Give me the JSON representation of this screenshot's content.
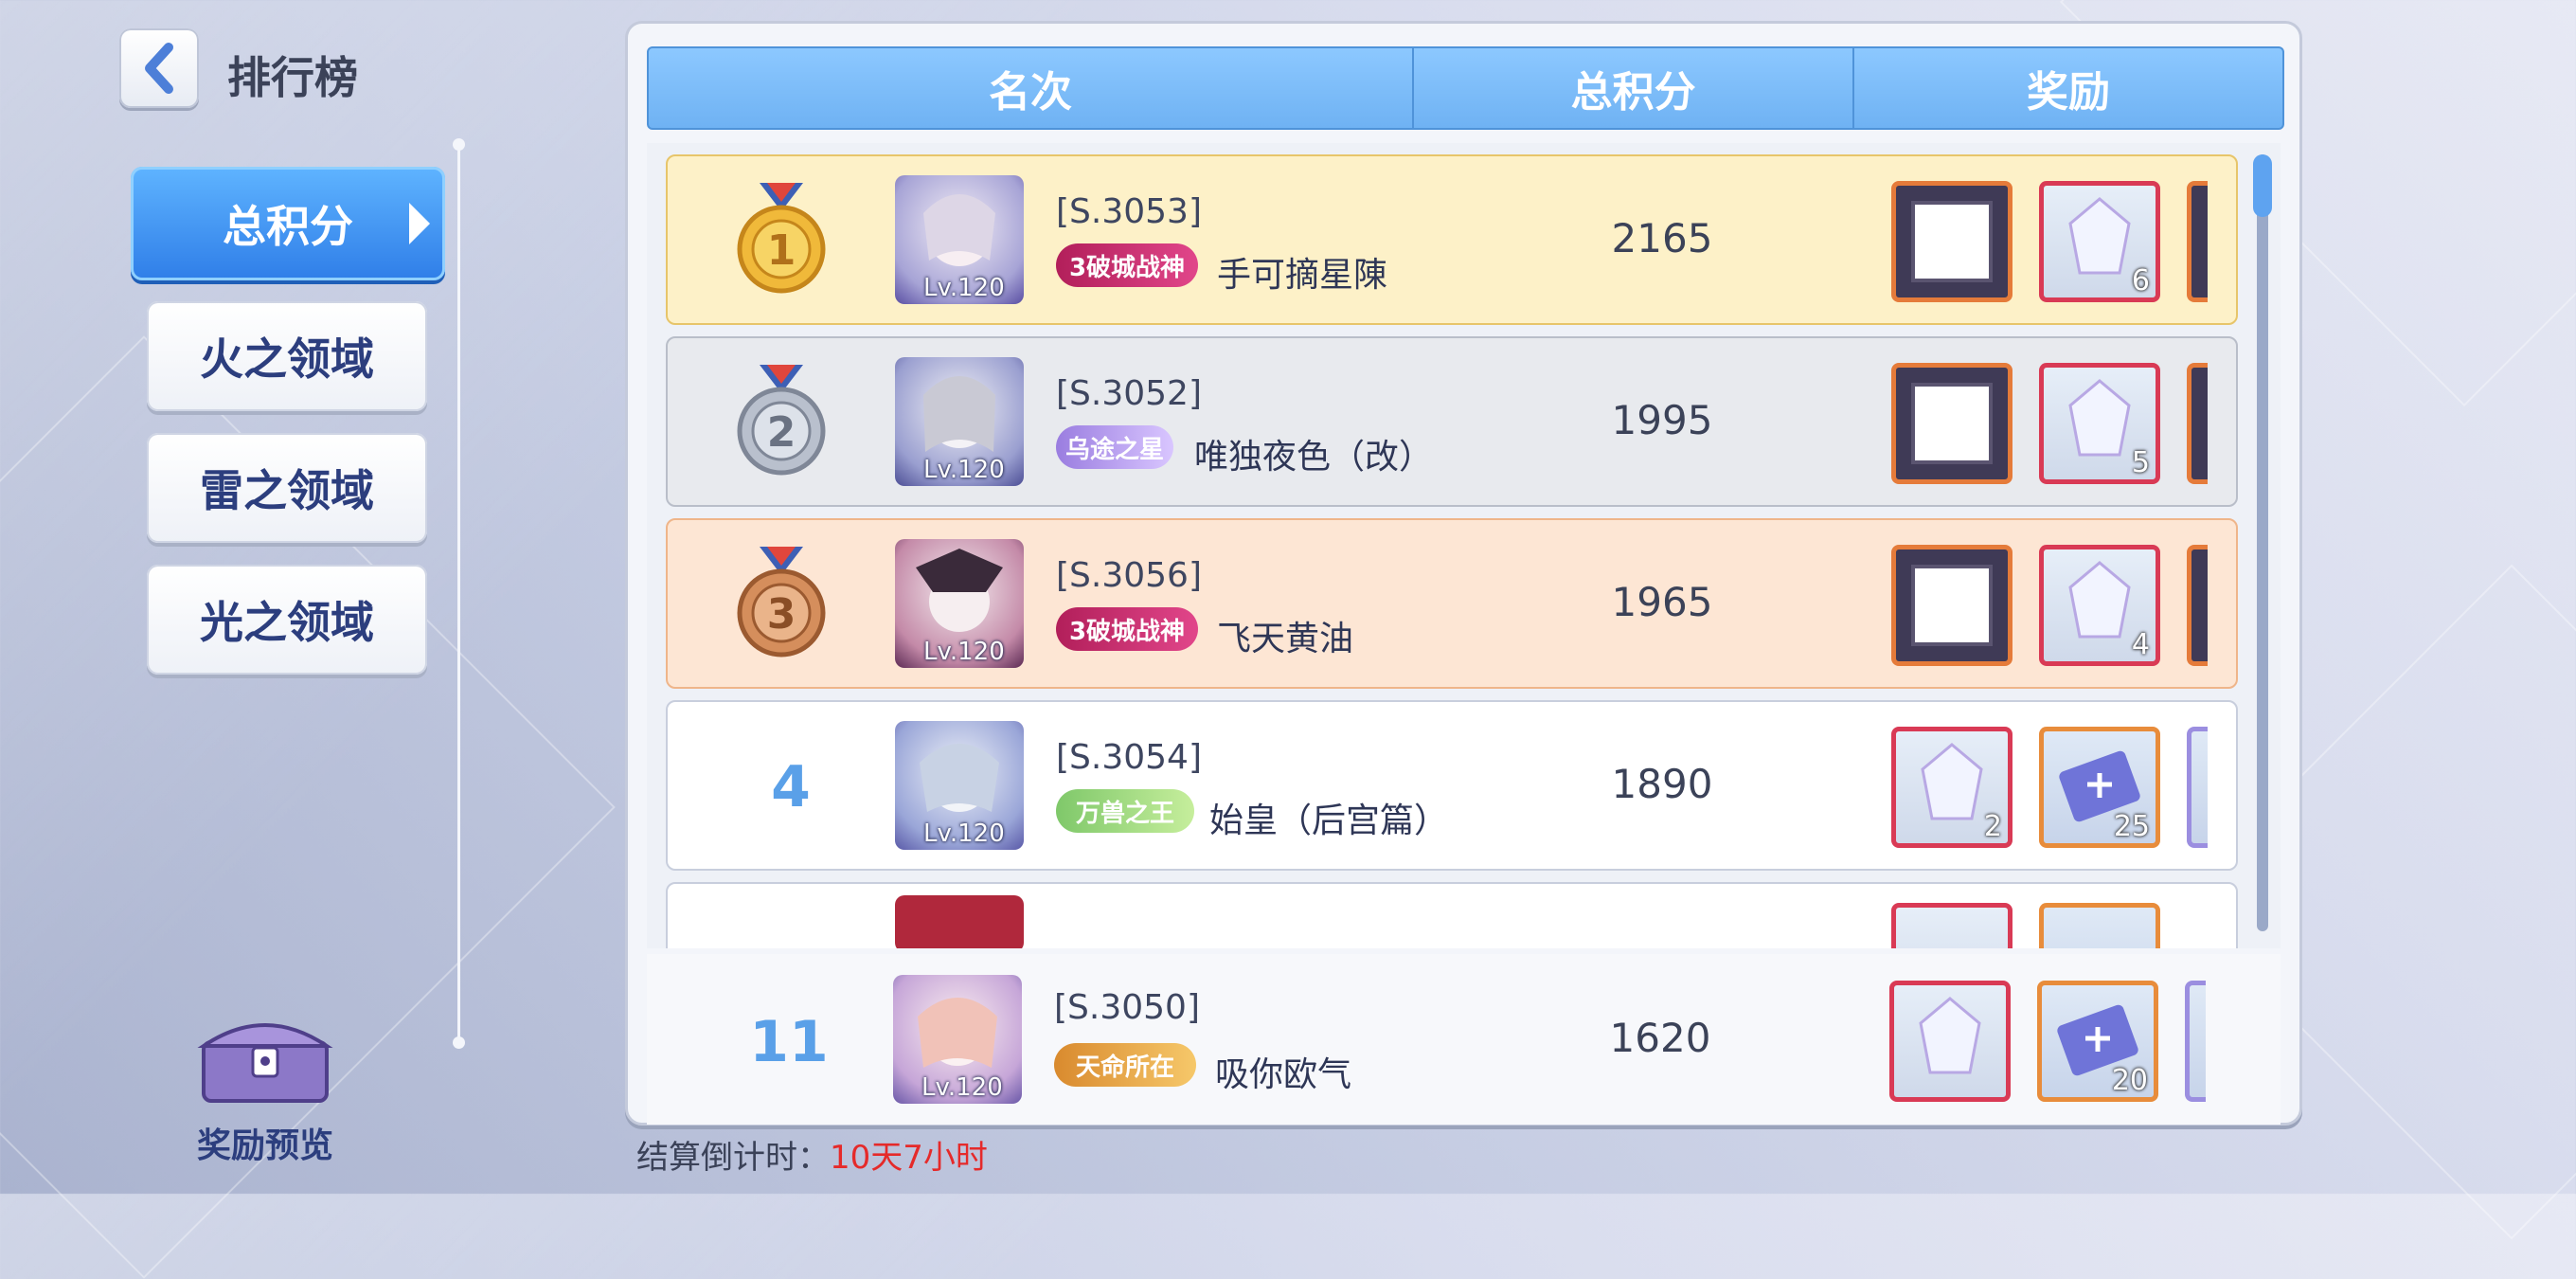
{
  "header": {
    "title": "排行榜"
  },
  "side_tabs": [
    {
      "label": "总积分",
      "active": true
    },
    {
      "label": "火之领域",
      "active": false
    },
    {
      "label": "雷之领域",
      "active": false
    },
    {
      "label": "光之领域",
      "active": false
    }
  ],
  "reward_preview": {
    "label": "奖励预览"
  },
  "table": {
    "columns": [
      "名次",
      "总积分",
      "奖励"
    ],
    "rows": [
      {
        "rank": "1",
        "level": "Lv.120",
        "server": "[S.3053]",
        "title_badge": "3破城战神",
        "name": "手可摘星陳",
        "score": "2165",
        "rewards": [
          {
            "type": "frame",
            "qty": ""
          },
          {
            "type": "crystal",
            "qty": "6"
          }
        ]
      },
      {
        "rank": "2",
        "level": "Lv.120",
        "server": "[S.3052]",
        "title_badge": "乌途之星",
        "name": "唯独夜色（改）",
        "score": "1995",
        "rewards": [
          {
            "type": "frame",
            "qty": ""
          },
          {
            "type": "crystal",
            "qty": "5"
          }
        ]
      },
      {
        "rank": "3",
        "level": "Lv.120",
        "server": "[S.3056]",
        "title_badge": "3破城战神",
        "name": "飞天黄油",
        "score": "1965",
        "rewards": [
          {
            "type": "frame",
            "qty": ""
          },
          {
            "type": "crystal",
            "qty": "4"
          }
        ]
      },
      {
        "rank": "4",
        "level": "Lv.120",
        "server": "[S.3054]",
        "title_badge": "万兽之王",
        "name": "始皇（后宫篇）",
        "score": "1890",
        "rewards": [
          {
            "type": "crystal",
            "qty": "2"
          },
          {
            "type": "ticket",
            "qty": "25"
          }
        ]
      }
    ],
    "my_row": {
      "rank": "11",
      "level": "Lv.120",
      "server": "[S.3050]",
      "title_badge": "天命所在",
      "name": "吸你欧气",
      "score": "1620",
      "rewards": [
        {
          "type": "crystal",
          "qty": ""
        },
        {
          "type": "ticket",
          "qty": "20"
        }
      ]
    }
  },
  "countdown": {
    "label": "结算倒计时：",
    "value": "10天7小时"
  },
  "colors": {
    "accent": "#2f7ee8",
    "header": "#8cc8ff",
    "countdown": "#e52a2a"
  }
}
